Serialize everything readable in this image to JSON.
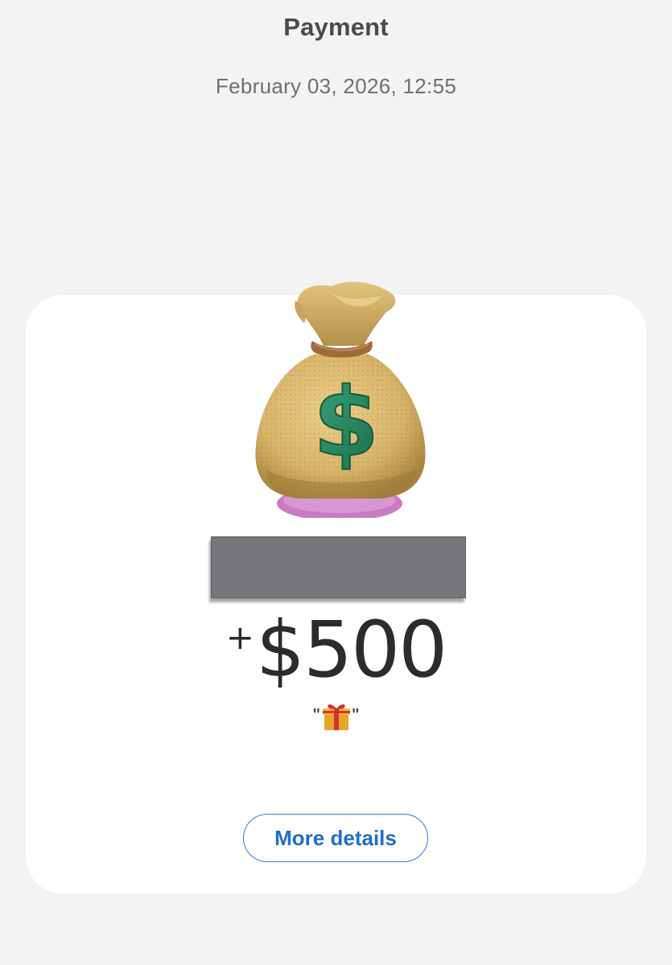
{
  "header": {
    "title": "Payment",
    "date": "February 03, 2026, 12:55"
  },
  "transaction": {
    "amount_sign": "+",
    "amount": "$500",
    "note_open_quote": "\"",
    "note_close_quote": "\"",
    "note_icon": "gift-icon"
  },
  "sender": {
    "avatar_icon": "money-bag-icon",
    "name_redacted": true
  },
  "actions": {
    "more_details_label": "More details"
  },
  "colors": {
    "background": "#f3f3f4",
    "card": "#ffffff",
    "accent": "#1e6fce",
    "amount_text": "#2b2c30"
  }
}
